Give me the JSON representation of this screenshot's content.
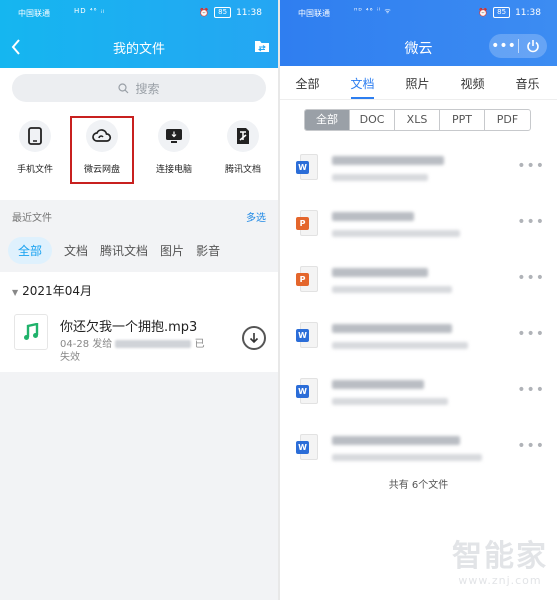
{
  "left": {
    "status_bar": {
      "carrier": "中国联通",
      "signal": "HD ⁴⁶ ᵢₗ",
      "battery": "85",
      "time": "11:38"
    },
    "title": "我的文件",
    "search_placeholder": "搜索",
    "quick_entries": [
      {
        "label": "手机文件",
        "icon": "phone-icon"
      },
      {
        "label": "微云网盘",
        "icon": "cloud-icon"
      },
      {
        "label": "连接电脑",
        "icon": "monitor-icon"
      },
      {
        "label": "腾讯文档",
        "icon": "tencent-docs-icon"
      }
    ],
    "recent_title": "最近文件",
    "multi_select": "多选",
    "type_tabs": [
      "全部",
      "文档",
      "腾讯文档",
      "图片",
      "影音"
    ],
    "month_header": "2021年04月",
    "file": {
      "name": "你还欠我一个拥抱.mp3",
      "date": "04-28",
      "sent_prefix": "发给",
      "status_1": "已",
      "status_2": "失效"
    }
  },
  "right": {
    "status_bar": {
      "carrier": "中国联通",
      "battery": "85",
      "time": "11:38"
    },
    "title": "微云",
    "tabs": [
      "全部",
      "文档",
      "照片",
      "视频",
      "音乐"
    ],
    "filters": [
      "全部",
      "DOC",
      "XLS",
      "PPT",
      "PDF"
    ],
    "docs": [
      {
        "type": "W",
        "color": "#2b6dd8"
      },
      {
        "type": "P",
        "color": "#e4662c"
      },
      {
        "type": "P",
        "color": "#e4662c"
      },
      {
        "type": "W",
        "color": "#2b6dd8"
      },
      {
        "type": "W",
        "color": "#2b6dd8"
      },
      {
        "type": "W",
        "color": "#2b6dd8"
      }
    ],
    "total": "共有 6个文件"
  },
  "watermark": {
    "main": "智能家",
    "sub": "www.znj.com"
  }
}
